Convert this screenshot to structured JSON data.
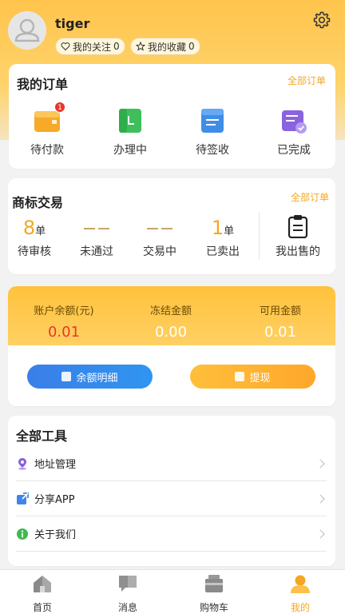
{
  "profile": {
    "username": "tiger",
    "follow_label": "我的关注",
    "follow_count": "0",
    "favorite_label": "我的收藏",
    "favorite_count": "0"
  },
  "orders": {
    "title": "我的订单",
    "all_link": "全部订单",
    "items": [
      {
        "label": "待付款",
        "icon": "wallet-icon",
        "badge": "1"
      },
      {
        "label": "办理中",
        "icon": "processing-icon"
      },
      {
        "label": "待签收",
        "icon": "receipt-icon"
      },
      {
        "label": "已完成",
        "icon": "completed-icon"
      }
    ]
  },
  "trademark": {
    "title": "商标交易",
    "all_link": "全部订单",
    "stats": [
      {
        "value": "8",
        "unit": "单",
        "label": "待审核"
      },
      {
        "value": "--",
        "unit": "",
        "label": "未通过"
      },
      {
        "value": "--",
        "unit": "",
        "label": "交易中"
      },
      {
        "value": "1",
        "unit": "单",
        "label": "已卖出"
      }
    ],
    "my_sold_label": "我出售的"
  },
  "balance": {
    "cols": [
      {
        "label": "账户余额(元)",
        "value": "0.01",
        "color": "#e8362e"
      },
      {
        "label": "冻结金额",
        "value": "0.00",
        "color": "#ffffff"
      },
      {
        "label": "可用金额",
        "value": "0.01",
        "color": "#ffffff"
      }
    ],
    "detail_button": "余额明细",
    "withdraw_button": "提现"
  },
  "tools": {
    "title": "全部工具",
    "items": [
      {
        "label": "地址管理",
        "icon": "location-icon"
      },
      {
        "label": "分享APP",
        "icon": "share-icon"
      },
      {
        "label": "关于我们",
        "icon": "info-icon"
      }
    ]
  },
  "tabbar": {
    "items": [
      {
        "label": "首页",
        "icon": "home-icon"
      },
      {
        "label": "消息",
        "icon": "message-icon"
      },
      {
        "label": "购物车",
        "icon": "cart-icon"
      },
      {
        "label": "我的",
        "icon": "profile-icon",
        "active": true
      }
    ]
  },
  "colors": {
    "accent": "#f5a623",
    "header_yellow": "#ffc44d",
    "button_blue": "#2f95f0",
    "alert_red": "#e8362e"
  }
}
